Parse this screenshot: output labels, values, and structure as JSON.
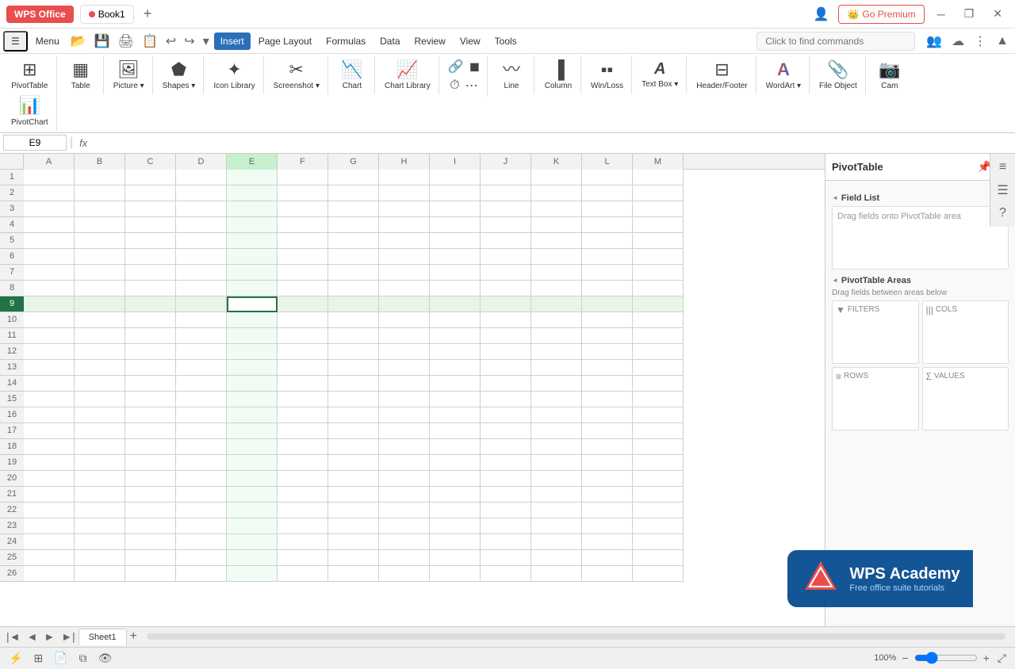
{
  "titlebar": {
    "wps_label": "WPS Office",
    "book_name": "Book1",
    "new_tab_icon": "+",
    "premium_label": "Go Premium",
    "win_minimize": "─",
    "win_restore": "❐",
    "win_close": "✕"
  },
  "menubar": {
    "items": [
      {
        "id": "menu-icon",
        "label": "☰"
      },
      {
        "id": "menu-menu",
        "label": "Menu"
      },
      {
        "id": "menu-home",
        "label": ""
      },
      {
        "id": "menu-undo",
        "label": "↩"
      },
      {
        "id": "menu-redo",
        "label": "↪"
      },
      {
        "id": "menu-more",
        "label": "▾"
      },
      {
        "id": "menu-save",
        "label": ""
      },
      {
        "id": "menu-open",
        "label": ""
      },
      {
        "id": "menu-insert",
        "label": "Insert",
        "active": true
      },
      {
        "id": "menu-pagelayout",
        "label": "Page Layout"
      },
      {
        "id": "menu-formulas",
        "label": "Formulas"
      },
      {
        "id": "menu-data",
        "label": "Data"
      },
      {
        "id": "menu-review",
        "label": "Review"
      },
      {
        "id": "menu-view",
        "label": "View"
      },
      {
        "id": "menu-tools",
        "label": "Tools"
      }
    ],
    "search_placeholder": "Click to find commands"
  },
  "ribbon": {
    "groups": [
      {
        "id": "pivottable-group",
        "buttons": [
          {
            "id": "pivottable-btn",
            "icon": "⊞",
            "label": "PivotTable"
          },
          {
            "id": "pivotchart-btn",
            "icon": "📊",
            "label": "PivotChart"
          }
        ]
      },
      {
        "id": "table-group",
        "buttons": [
          {
            "id": "table-btn",
            "icon": "▦",
            "label": "Table"
          }
        ]
      },
      {
        "id": "picture-group",
        "buttons": [
          {
            "id": "picture-btn",
            "icon": "🖼",
            "label": "Picture",
            "has_arrow": true
          }
        ]
      },
      {
        "id": "shapes-group",
        "buttons": [
          {
            "id": "shapes-btn",
            "icon": "⬟",
            "label": "Shapes",
            "has_arrow": true
          }
        ]
      },
      {
        "id": "iconlibrary-group",
        "buttons": [
          {
            "id": "iconlibrary-btn",
            "icon": "✦",
            "label": "Icon Library"
          }
        ]
      },
      {
        "id": "screenshot-group",
        "buttons": [
          {
            "id": "screenshot-btn",
            "icon": "✂",
            "label": "Screenshot",
            "has_arrow": true
          }
        ]
      },
      {
        "id": "chart-group",
        "buttons": [
          {
            "id": "chart-btn",
            "icon": "📉",
            "label": "Chart"
          }
        ]
      },
      {
        "id": "chartlibrary-group",
        "buttons": [
          {
            "id": "chartlibrary-btn",
            "icon": "📈",
            "label": "Chart Library"
          }
        ]
      },
      {
        "id": "links-group",
        "buttons": [
          {
            "id": "links-btn",
            "icon": "🔗",
            "label": "",
            "has_arrow": true
          }
        ]
      },
      {
        "id": "shapes2-group",
        "buttons": [
          {
            "id": "shapes2-btn",
            "icon": "◼",
            "label": "",
            "has_arrow": true
          }
        ]
      },
      {
        "id": "time-group",
        "buttons": [
          {
            "id": "time-btn",
            "icon": "⏱",
            "label": "",
            "has_arrow": true
          }
        ]
      },
      {
        "id": "sparkline-group",
        "buttons": [
          {
            "id": "sparkline-btn",
            "icon": "⋯",
            "label": "",
            "has_arrow": true
          }
        ]
      },
      {
        "id": "line-group",
        "buttons": [
          {
            "id": "line-btn",
            "icon": "〰",
            "label": "Line"
          }
        ]
      },
      {
        "id": "column-group",
        "buttons": [
          {
            "id": "column-btn",
            "icon": "▐",
            "label": "Column"
          }
        ]
      },
      {
        "id": "winloss-group",
        "buttons": [
          {
            "id": "winloss-btn",
            "icon": "▪▪",
            "label": "Win/Loss"
          }
        ]
      },
      {
        "id": "textbox-group",
        "buttons": [
          {
            "id": "textbox-btn",
            "icon": "Ａ",
            "label": "Text Box",
            "has_arrow": true
          }
        ]
      },
      {
        "id": "headerfooter-group",
        "buttons": [
          {
            "id": "headerfooter-btn",
            "icon": "⊟",
            "label": "Header/Footer"
          }
        ]
      },
      {
        "id": "wordart-group",
        "buttons": [
          {
            "id": "wordart-btn",
            "icon": "A",
            "label": "WordArt",
            "has_arrow": true
          }
        ]
      },
      {
        "id": "fileobject-group",
        "buttons": [
          {
            "id": "fileobject-btn",
            "icon": "📎",
            "label": "File Object"
          }
        ]
      },
      {
        "id": "camera-group",
        "buttons": [
          {
            "id": "camera-btn",
            "icon": "📷",
            "label": "Cam"
          }
        ]
      }
    ]
  },
  "formulabar": {
    "cell_ref": "E9",
    "fx_label": "fx"
  },
  "columns": [
    "A",
    "B",
    "C",
    "D",
    "E",
    "F",
    "G",
    "H",
    "I",
    "J",
    "K",
    "L",
    "M"
  ],
  "rows": [
    1,
    2,
    3,
    4,
    5,
    6,
    7,
    8,
    9,
    10,
    11,
    12,
    13,
    14,
    15,
    16,
    17,
    18,
    19,
    20,
    21,
    22,
    23,
    24,
    25,
    26
  ],
  "active_cell": {
    "row": 9,
    "col": 4
  },
  "sheet_tabs": [
    {
      "label": "Sheet1",
      "active": true
    }
  ],
  "right_panel": {
    "title": "PivotTable",
    "field_list_label": "Field List",
    "field_list_placeholder": "Drag fields onto PivotTable area",
    "areas_label": "PivotTable Areas",
    "areas_placeholder": "Drag fields between areas below",
    "areas": [
      {
        "id": "filters",
        "label": "FILTERS",
        "icon": "▼"
      },
      {
        "id": "cols",
        "label": "COLS",
        "icon": "|||"
      },
      {
        "id": "rows",
        "label": "ROWS",
        "icon": "≡"
      },
      {
        "id": "values",
        "label": "VALUES",
        "icon": "Σ"
      }
    ]
  },
  "statusbar": {
    "items": [
      {
        "id": "macro-btn",
        "label": "⚡"
      },
      {
        "id": "grid-view-btn",
        "label": "⊞"
      },
      {
        "id": "page-view-btn",
        "label": "📄"
      },
      {
        "id": "multi-view-btn",
        "label": "⧉"
      },
      {
        "id": "eye-btn",
        "label": "👁"
      }
    ],
    "zoom_level": "100%",
    "zoom_percent": 100
  },
  "watermark": {
    "logo": "▶",
    "brand": "WPS Academy",
    "tagline": "Free office suite tutorials"
  }
}
